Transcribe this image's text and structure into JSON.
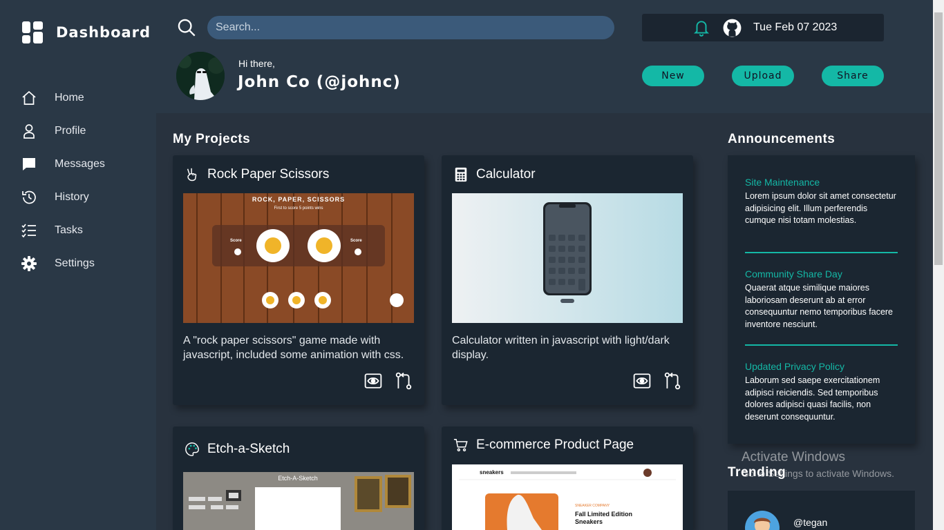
{
  "sidebar": {
    "brand": "Dashboard",
    "items": [
      {
        "label": "Home",
        "icon": "home-icon"
      },
      {
        "label": "Profile",
        "icon": "profile-icon"
      },
      {
        "label": "Messages",
        "icon": "message-icon"
      },
      {
        "label": "History",
        "icon": "history-icon"
      },
      {
        "label": "Tasks",
        "icon": "tasks-icon"
      },
      {
        "label": "Settings",
        "icon": "gear-icon"
      }
    ]
  },
  "header": {
    "search_placeholder": "Search...",
    "date": "Tue Feb 07 2023",
    "greeting": "Hi there,",
    "user": "John Co (@johnc)",
    "buttons": {
      "new": "New",
      "upload": "Upload",
      "share": "Share"
    }
  },
  "projects": {
    "title": "My Projects",
    "items": [
      {
        "title": "Rock Paper Scissors",
        "icon": "hand-peace-icon",
        "desc": "A \"rock paper scissors\" game made with javascript, included some animation with css.",
        "thumb_title": "ROCK, PAPER, SCISSORS",
        "thumb_subtitle": "First to score 5 points wins",
        "score_label": "Score"
      },
      {
        "title": "Calculator",
        "icon": "calculator-icon",
        "desc": "Calculator written in javascript with light/dark display."
      },
      {
        "title": "Etch-a-Sketch",
        "icon": "palette-icon",
        "desc": "",
        "thumb_title": "Etch-A-Sketch"
      },
      {
        "title": "E-commerce Product Page",
        "icon": "cart-icon",
        "desc": "",
        "thumb_brand": "sneakers",
        "thumb_company": "SNEAKER COMPANY",
        "thumb_product": "Fall Limited Edition Sneakers"
      }
    ]
  },
  "announcements": {
    "title": "Announcements",
    "items": [
      {
        "title": "Site Maintenance",
        "body": "Lorem ipsum dolor sit amet consectetur adipisicing elit. Illum perferendis cumque nisi totam molestias."
      },
      {
        "title": "Community Share Day",
        "body": "Quaerat atque similique maiores laboriosam deserunt ab at error consequuntur nemo temporibus facere inventore nesciunt."
      },
      {
        "title": "Updated Privacy Policy",
        "body": "Laborum sed saepe exercitationem adipisci reiciendis. Sed temporibus dolores adipisci quasi facilis, non deserunt consequuntur."
      }
    ]
  },
  "trending": {
    "title": "Trending",
    "items": [
      {
        "handle": "@tegan"
      }
    ]
  },
  "watermark": {
    "line1": "Activate Windows",
    "line2": "Go to Settings to activate Windows."
  },
  "colors": {
    "accent": "#14b8a6",
    "sidebar": "#2a3846",
    "card": "#1b2631",
    "background": "#28323e"
  }
}
